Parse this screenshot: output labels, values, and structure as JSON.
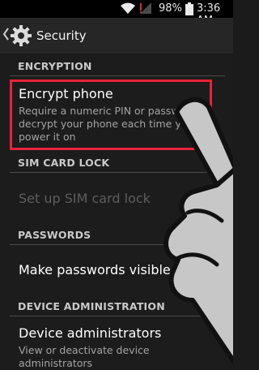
{
  "status_bar": {
    "battery": "98%",
    "time": "3:36 AM"
  },
  "action_bar": {
    "title": "Security"
  },
  "sections": {
    "encryption": {
      "header": "ENCRYPTION",
      "title": "Encrypt phone",
      "subtitle": "Require a numeric PIN or password to decrypt your phone each time you power it on"
    },
    "sim": {
      "header": "SIM CARD LOCK",
      "title": "Set up SIM card lock"
    },
    "passwords": {
      "header": "PASSWORDS",
      "title": "Make passwords visible",
      "checked": true
    },
    "device_admin": {
      "header": "DEVICE ADMINISTRATION",
      "title": "Device administrators",
      "subtitle": "View or deactivate device administrators"
    }
  },
  "colors": {
    "highlight": "#e8223a",
    "accent": "#33b5e5"
  },
  "icons": [
    "wifi-icon",
    "signal-icon",
    "battery-icon",
    "back-icon",
    "gear-icon",
    "checkbox-icon",
    "pointing-hand"
  ]
}
